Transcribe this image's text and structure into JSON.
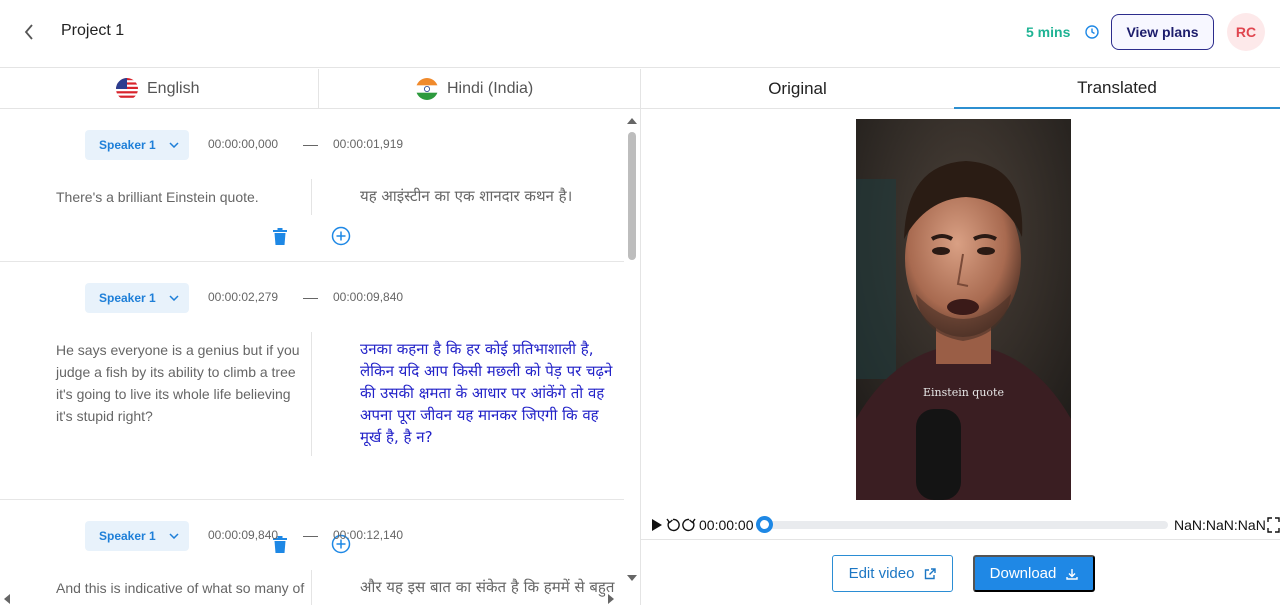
{
  "header": {
    "title": "Project 1",
    "minutes_left": "5 mins",
    "view_plans": "View plans",
    "avatar_initials": "RC"
  },
  "languages": {
    "source": "English",
    "target": "Hindi (India)"
  },
  "segments": [
    {
      "speaker": "Speaker 1",
      "start": "00:00:00,000",
      "end": "00:00:01,919",
      "source_text": "There's a brilliant Einstein quote.",
      "target_text": "यह आइंस्टीन का एक शानदार कथन है।"
    },
    {
      "speaker": "Speaker 1",
      "start": "00:00:02,279",
      "end": "00:00:09,840",
      "source_text": "He says everyone is a genius but if you judge a fish by its ability to climb a tree it's going to live its whole life believing it's stupid right?",
      "target_text": "उनका कहना है कि हर कोई प्रतिभाशाली है, लेकिन यदि आप किसी मछली को पेड़ पर चढ़ने की उसकी क्षमता के आधार पर आंकेंगे तो वह अपना पूरा जीवन यह मानकर जिएगी कि वह मूर्ख है, है न?"
    },
    {
      "speaker": "Speaker 1",
      "start": "00:00:09,840",
      "end": "00:00:12,140",
      "source_text": "And this is indicative of what so many of",
      "target_text": "और यह इस बात का संकेत है कि हममें से बहुत"
    }
  ],
  "preview": {
    "tab_original": "Original",
    "tab_translated": "Translated",
    "active_tab": "Translated",
    "caption": "Einstein quote"
  },
  "player": {
    "current_time": "00:00:00",
    "duration": "NaN:NaN:NaN",
    "progress": 0
  },
  "actions": {
    "edit_video": "Edit video",
    "download": "Download"
  },
  "colors": {
    "accent": "#1f88e5",
    "minutes_green": "#1fb394",
    "active_translation": "#2222c8",
    "avatar_text": "#e0464f"
  }
}
